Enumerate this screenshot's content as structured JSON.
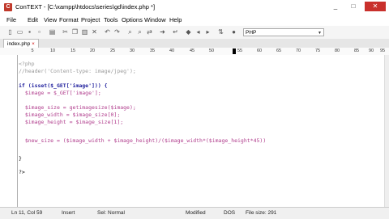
{
  "window": {
    "title": "ConTEXT - [C:\\xampp\\htdocs\\series\\gd\\index.php *]",
    "app_icon_letter": "C",
    "controls": {
      "minimize": "_",
      "maximize": "□",
      "close": "✕"
    }
  },
  "menu": [
    "File",
    "Edit",
    "View",
    "Format",
    "Project",
    "Tools",
    "Options",
    "Window",
    "Help"
  ],
  "toolbar": {
    "icons": [
      "new-file-icon",
      "open-folder-icon",
      "save-icon",
      "save-all-icon",
      "print-icon",
      "cut-icon",
      "copy-icon",
      "paste-icon",
      "clear-icon",
      "undo-icon",
      "redo-icon",
      "find-icon",
      "find-next-icon",
      "replace-icon",
      "goto-icon",
      "word-wrap-icon",
      "bookmark-icon",
      "bookmark-prev-icon",
      "bookmark-next-icon",
      "sort-icon",
      "macro-icon"
    ],
    "language_select": "PHP"
  },
  "tabs": [
    {
      "label": "index.php",
      "close": "×"
    }
  ],
  "ruler": [
    "5",
    "10",
    "15",
    "20",
    "25",
    "30",
    "35",
    "40",
    "45",
    "50",
    "55",
    "60",
    "65",
    "70",
    "75",
    "80",
    "85",
    "90",
    "95"
  ],
  "editor": {
    "lines": [
      "<?php",
      "//header('Content-type: image/jpeg');",
      "",
      "if (isset($_GET['image'])) {",
      "  $image = $_GET['image'];",
      "",
      "  $image_size = getimagesize($image);",
      "  $image_width = $image_size[0];",
      "  $image_height = $image_size[1];",
      "",
      "  $new_size = ($image_width + $image_height)/($image_width*($image_height*45))",
      "",
      "",
      "}",
      "",
      "?>"
    ]
  },
  "status": {
    "position": "Ln 11, Col 59",
    "mode": "Insert",
    "selection": "Sel: Normal",
    "modified": "Modified",
    "format": "DOS",
    "file_size": "File size: 291"
  }
}
